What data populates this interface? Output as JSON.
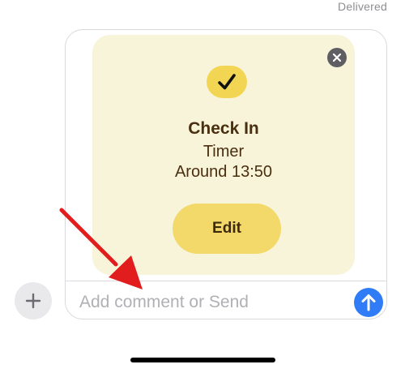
{
  "status": {
    "delivered": "Delivered"
  },
  "card": {
    "title": "Check In",
    "line1": "Timer",
    "line2": "Around 13:50",
    "edit_label": "Edit",
    "accent_color": "#f3d554",
    "background_color": "#f8f4d9"
  },
  "composer": {
    "placeholder": "Add comment or Send",
    "value": "",
    "send_color": "#2f7cf6"
  },
  "icons": {
    "plus": "plus-icon",
    "close": "close-icon",
    "check": "checkmark-icon",
    "send": "arrow-up-icon",
    "annotation": "red-arrow-icon"
  }
}
